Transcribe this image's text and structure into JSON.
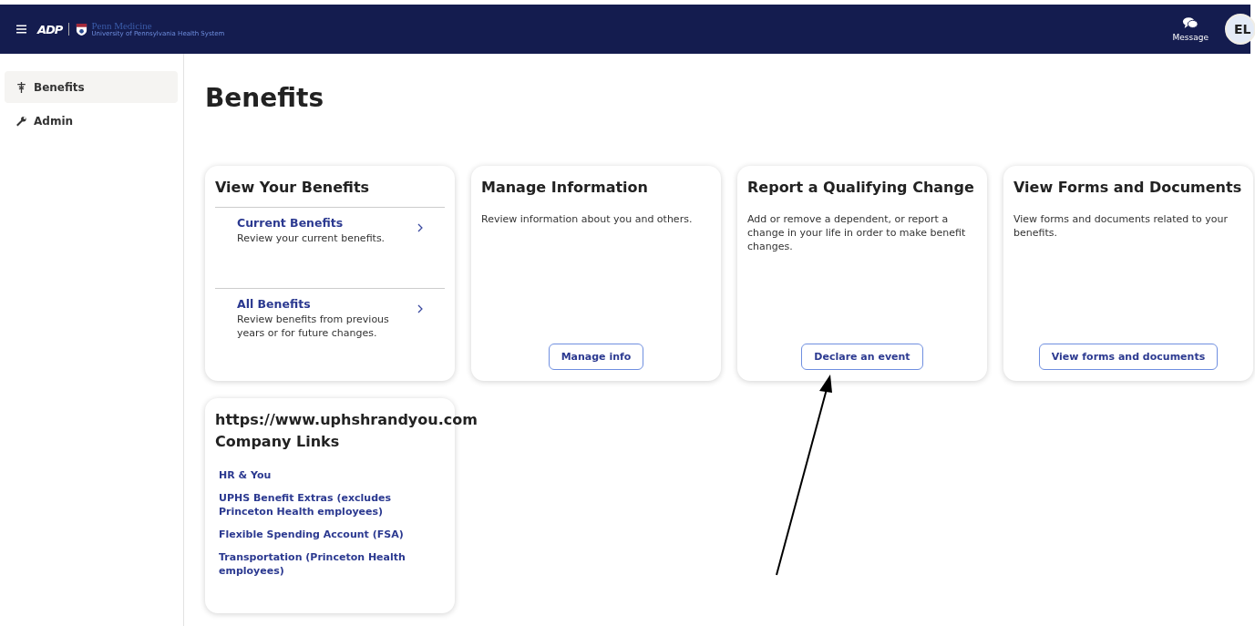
{
  "header": {
    "brand": "ADP",
    "org_name": "Penn Medicine",
    "org_subtitle": "University of Pennsylvania Health System",
    "message_label": "Message",
    "avatar_initials": "EL"
  },
  "sidebar": {
    "items": [
      {
        "label": "Benefits",
        "kind": "benefits",
        "selected": true
      },
      {
        "label": "Admin",
        "kind": "admin",
        "selected": false
      }
    ]
  },
  "page_title": "Benefits",
  "cards": [
    {
      "kind": "links",
      "title": "View Your Benefits",
      "items": [
        {
          "title": "Current Benefits",
          "description": "Review your current benefits."
        },
        {
          "title": "All Benefits",
          "description": "Review benefits from previous years or for future changes."
        }
      ]
    },
    {
      "kind": "action",
      "title": "Manage Information",
      "description": "Review information about you and others.",
      "button": "Manage info"
    },
    {
      "kind": "action",
      "title": "Report a Qualifying Change",
      "description": "Add or remove a dependent, or report a change in your life in order to make benefit changes.",
      "button": "Declare an event"
    },
    {
      "kind": "action",
      "title": "View Forms and Documents",
      "description": "View forms and documents related to your benefits.",
      "button": "View forms and documents"
    }
  ],
  "company_links": {
    "url": "https://www.uphshrandyou.com",
    "title": "Company Links",
    "links": [
      "HR & You",
      "UPHS Benefit Extras (excludes Princeton Health employees)",
      "Flexible Spending Account (FSA)",
      "Transportation (Princeton Health employees)"
    ]
  }
}
